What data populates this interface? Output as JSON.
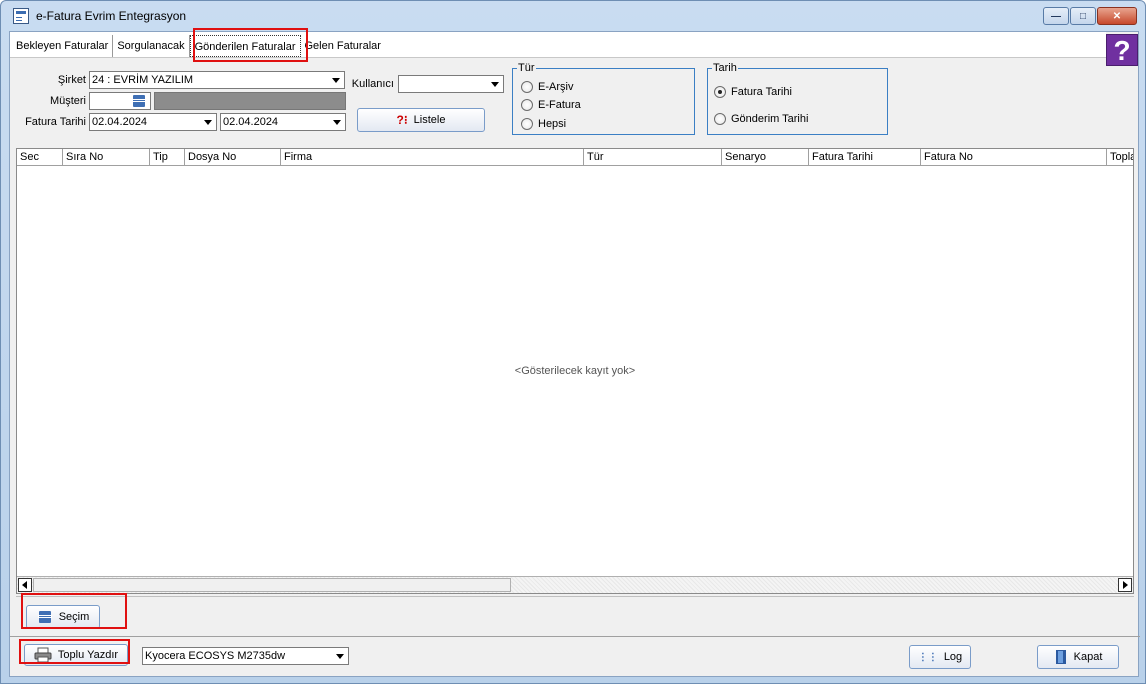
{
  "window": {
    "title": "e-Fatura Evrim Entegrasyon",
    "help_label": "?"
  },
  "tabs": [
    {
      "label": "Bekleyen Faturalar"
    },
    {
      "label": "Sorgulanacak"
    },
    {
      "label": "Gönderilen Faturalar"
    },
    {
      "label": "Gelen Faturalar"
    }
  ],
  "filters": {
    "sirket_label": "Şirket",
    "sirket_value": "24 : EVRİM YAZILIM",
    "musteri_label": "Müşteri",
    "fatura_tarihi_label": "Fatura Tarihi",
    "date_from": "02.04.2024",
    "date_to": "02.04.2024",
    "kullanici_label": "Kullanıcı",
    "listele_label": "Listele",
    "tur_group": {
      "title": "Tür",
      "options": [
        {
          "label": "E-Arşiv",
          "checked": false
        },
        {
          "label": "E-Fatura",
          "checked": false
        },
        {
          "label": "Hepsi",
          "checked": false
        }
      ]
    },
    "tarih_group": {
      "title": "Tarih",
      "options": [
        {
          "label": "Fatura Tarihi",
          "checked": true
        },
        {
          "label": "Gönderim Tarihi",
          "checked": false
        }
      ]
    }
  },
  "grid": {
    "columns": [
      "Sec",
      "Sıra No",
      "Tip",
      "Dosya No",
      "Firma",
      "Tür",
      "Senaryo",
      "Fatura Tarihi",
      "Fatura No",
      "Topla"
    ],
    "empty_text": "<Gösterilecek kayıt yok>"
  },
  "actions": {
    "secim_label": "Seçim",
    "toplu_yazdir_label": "Toplu Yazdır",
    "printer_value": "Kyocera ECOSYS M2735dw",
    "log_label": "Log",
    "kapat_label": "Kapat"
  },
  "colors": {
    "highlight": "#e01010",
    "help_bg": "#7030a0",
    "group_border": "#3b7fc4"
  }
}
